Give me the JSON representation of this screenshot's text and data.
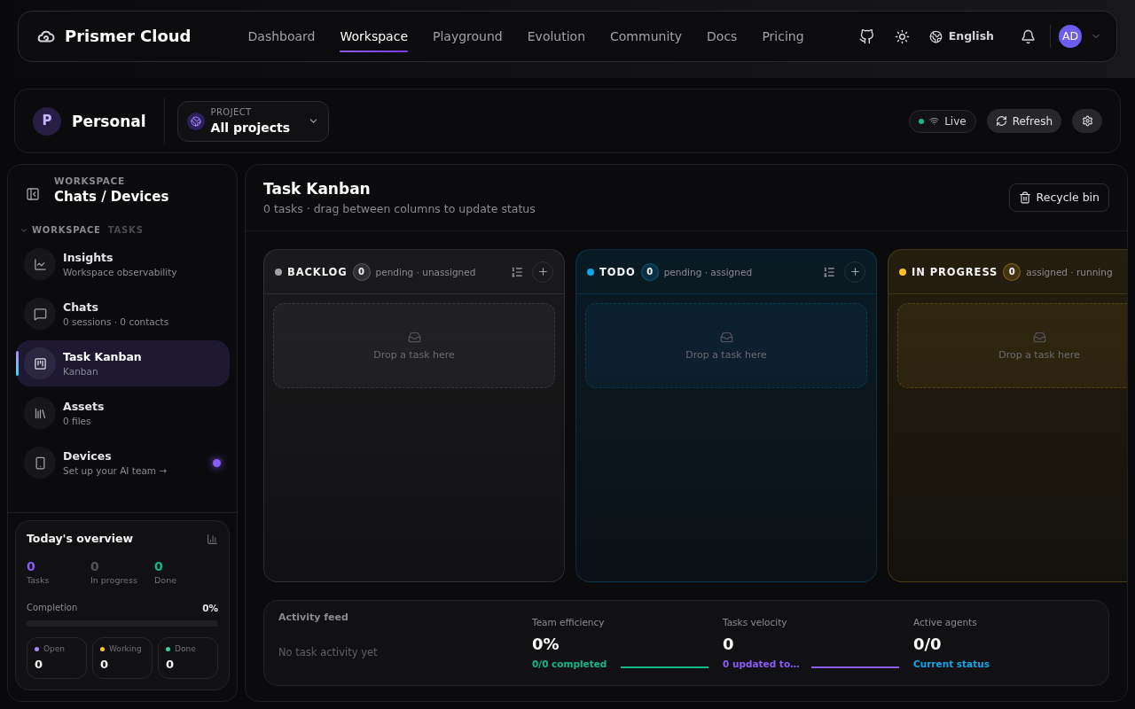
{
  "nav": {
    "brand": "Prismer Cloud",
    "tabs": [
      {
        "label": "Dashboard",
        "selected": false
      },
      {
        "label": "Workspace",
        "selected": true
      },
      {
        "label": "Playground",
        "selected": false
      },
      {
        "label": "Evolution",
        "selected": false
      },
      {
        "label": "Community",
        "selected": false
      },
      {
        "label": "Docs",
        "selected": false
      },
      {
        "label": "Pricing",
        "selected": false
      }
    ],
    "language": "English",
    "avatar": "AD"
  },
  "header": {
    "workspace_initial": "P",
    "workspace_name": "Personal",
    "project": {
      "label": "PROJECT",
      "value": "All projects"
    },
    "live": {
      "label": "Live",
      "on": true
    },
    "refresh": "Refresh"
  },
  "sidebar": {
    "eyebrow": "WORKSPACE",
    "title": "Chats / Devices",
    "section": {
      "label": "WORKSPACE",
      "sublabel": "TASKS",
      "expanded": true
    },
    "items": [
      {
        "kind": "insights",
        "title": "Insights",
        "subtitle": "Workspace observability",
        "selected": false,
        "indicator": false
      },
      {
        "kind": "chats",
        "title": "Chats",
        "subtitle": "0 sessions · 0 contacts",
        "selected": false,
        "indicator": false
      },
      {
        "kind": "kanban",
        "title": "Task Kanban",
        "subtitle": "Kanban",
        "selected": true,
        "indicator": false
      },
      {
        "kind": "assets",
        "title": "Assets",
        "subtitle": "0 files",
        "selected": false,
        "indicator": false
      },
      {
        "kind": "devices",
        "title": "Devices",
        "subtitle": "Set up your AI team →",
        "selected": false,
        "indicator": true
      }
    ],
    "overview": {
      "title": "Today's overview",
      "stats": [
        {
          "value": "0",
          "label": "Tasks",
          "color": "#8b5cf6"
        },
        {
          "value": "0",
          "label": "In progress",
          "color": "#52525b"
        },
        {
          "value": "0",
          "label": "Done",
          "color": "#10b981"
        }
      ],
      "completion": {
        "label": "Completion",
        "reading": "0%",
        "level": 0
      },
      "legend": [
        {
          "label": "Open",
          "value": "0",
          "color": "#a78bfa"
        },
        {
          "label": "Working",
          "value": "0",
          "color": "#facc15"
        },
        {
          "label": "Done",
          "value": "0",
          "color": "#34d399"
        }
      ]
    }
  },
  "main": {
    "title": "Task Kanban",
    "subtitle": "0 tasks · drag between columns to update status",
    "recycle_bin": "Recycle bin",
    "columns": [
      {
        "title": "BACKLOG",
        "count": "0",
        "description": "pending · unassigned",
        "color": "#a1a1aa",
        "empty_text": "Drop a task here"
      },
      {
        "title": "TODO",
        "count": "0",
        "description": "pending · assigned",
        "color": "#0ea5e9",
        "empty_text": "Drop a task here"
      },
      {
        "title": "IN PROGRESS",
        "count": "0",
        "description": "assigned · running",
        "color": "#fbbf24",
        "empty_text": "Drop a task here"
      }
    ],
    "activity": {
      "title": "Activity feed",
      "empty_text": "No task activity yet",
      "stats": [
        {
          "label": "Team efficiency",
          "value": "0%",
          "detail": "0/0 completed",
          "color": "#10b981",
          "sparkline": true
        },
        {
          "label": "Tasks velocity",
          "value": "0",
          "detail": "0 updated to…",
          "color": "#8b5cf6",
          "sparkline": true
        },
        {
          "label": "Active agents",
          "value": "0/0",
          "detail": "Current status",
          "color": "#0ea5e9",
          "sparkline": false
        }
      ]
    }
  }
}
